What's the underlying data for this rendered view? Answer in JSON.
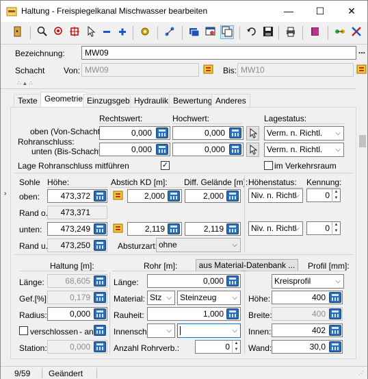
{
  "window": {
    "title": "Haltung - Freispiegelkanal Mischwasser bearbeiten",
    "minimize": "—",
    "maximize": "☐",
    "close": "✕"
  },
  "toolbar": {
    "icons": [
      "exit-icon",
      "zoom-icon",
      "zoom-object-icon",
      "crosshair-icon",
      "pointer-icon",
      "minus-icon",
      "plus-icon",
      "settings-icon",
      "network-icon",
      "window-list-icon",
      "window-edit-icon",
      "window-copy-icon",
      "undo-icon",
      "save-icon",
      "print-icon",
      "book-icon",
      "connect-icon",
      "tools-icon"
    ]
  },
  "header": {
    "bezeichnung_label": "Bezeichnung:",
    "bezeichnung_value": "MW09",
    "more_button": "...",
    "schacht_label": "Schacht",
    "von_label": "Von:",
    "von_value": "MW09",
    "bis_label": "Bis:",
    "bis_value": "MW10"
  },
  "tabs": [
    "Texte",
    "Geometrie",
    "Einzugsgeb.",
    "Hydraulik",
    "Bewertung",
    "Anderes"
  ],
  "rohranschluss": {
    "rechtswert_label": "Rechtswert:",
    "hochwert_label": "Hochwert:",
    "lagestatus_label": "Lagestatus:",
    "oben_label": "oben (Von-Schacht):",
    "rohr_label": "Rohranschluss:",
    "unten_label": "unten (Bis-Schacht):",
    "oben_rechtswert": "0,000",
    "oben_hochwert": "0,000",
    "unten_rechtswert": "0,000",
    "unten_hochwert": "0,000",
    "oben_lagestatus": "Verm. n. Richtl.",
    "unten_lagestatus": "Verm. n. Richtl.",
    "lage_mitfuehren_label": "Lage Rohranschluss mitführen",
    "lage_mitfuehren_checked": "✓",
    "verkehrsraum_label": "im Verkehrsraum"
  },
  "sohle": {
    "sohle_label": "Sohle",
    "hoehe_label": "Höhe:",
    "abstich_label": "Abstich KD [m]:",
    "diff_label": "Diff. Gelände [m]:",
    "hoehenstatus_label": "Höhenstatus:",
    "kennung_label": "Kennung:",
    "oben_label": "oben:",
    "oben_hoehe": "473,372",
    "oben_abstich": "2,000",
    "oben_diff": "2,000",
    "oben_status": "Niv. n. Richtl",
    "oben_kennung": "0",
    "rand_o_label": "Rand o.:",
    "rand_o_value": "473,371",
    "unten_label": "unten:",
    "unten_hoehe": "473,249",
    "unten_abstich": "2,119",
    "unten_diff": "2,119",
    "unten_status": "Niv. n. Richtl",
    "unten_kennung": "0",
    "rand_u_label": "Rand u.:",
    "rand_u_value": "473,250",
    "absturzart_label": "Absturzart:",
    "absturzart_value": "ohne"
  },
  "haltung": {
    "haltung_label": "Haltung [m]:",
    "rohr_label": "Rohr [m]:",
    "material_db_button": "aus Material-Datenbank ...",
    "profil_label": "Profil [mm]:",
    "laenge_label": "Länge:",
    "laenge_value": "68,605",
    "gef_label": "Gef.[%]",
    "gef_value": "0,179",
    "radius_label": "Radius:",
    "radius_value": "0,000",
    "verschlossen_label": "verschlossen",
    "an_label": "- an",
    "station_label": "Station:",
    "station_value": "0,000",
    "rohr_laenge_label": "Länge:",
    "rohr_laenge_value": "0,000",
    "material_label": "Material:",
    "material_code": "Stz",
    "material_name": "Steinzeug",
    "rauheit_label": "Rauheit:",
    "rauheit_value": "1,000",
    "innensch_label": "Innensch.:",
    "anzahl_label": "Anzahl Rohrverb.:",
    "anzahl_value": "0",
    "profil_value": "Kreisprofil",
    "hoehe_label": "Höhe:",
    "hoehe_value": "400",
    "breite_label": "Breite:",
    "breite_value": "400",
    "innen_label": "Innen:",
    "innen_value": "402",
    "wand_label": "Wand:",
    "wand_value": "30,0"
  },
  "status": {
    "record": "9/59",
    "state": "Geändert"
  }
}
